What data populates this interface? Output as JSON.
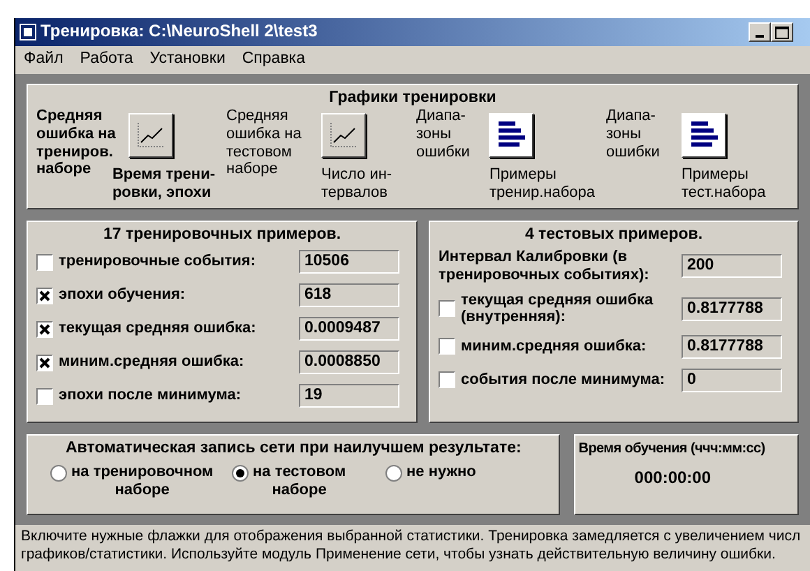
{
  "window": {
    "title": "Тренировка: C:\\NeuroShell 2\\test3"
  },
  "menu": [
    "Файл",
    "Работа",
    "Установки",
    "Справка"
  ],
  "charts": {
    "title": "Графики тренировки",
    "buttons": [
      {
        "side_label": "Средняя\nошибка на\nтрениров.\nнаборе",
        "under_label": "Время трени-\nровки, эпохи",
        "kind": "line",
        "selected": true
      },
      {
        "side_label": "Средняя\nошибка на\nтестовом\nнаборе",
        "under_label": "Число ин-\nтервалов",
        "kind": "line",
        "selected": false
      },
      {
        "side_label": "Диапа-\nзоны\nошибки",
        "under_label": "Примеры\nтренир.набора",
        "kind": "bars",
        "selected": false
      },
      {
        "side_label": "Диапа-\nзоны\nошибки",
        "under_label": "Примеры\nтест.набора",
        "kind": "bars",
        "selected": false
      }
    ]
  },
  "training": {
    "title": "17 тренировочных примеров.",
    "rows": [
      {
        "kind": "checkbox",
        "label": "тренировочные события:",
        "checked": false,
        "value": "10506"
      },
      {
        "kind": "checkbox",
        "label": "эпохи обучения:",
        "checked": true,
        "value": "618"
      },
      {
        "kind": "checkbox",
        "label": "текущая средняя ошибка:",
        "checked": true,
        "value": "0.0009487"
      },
      {
        "kind": "checkbox",
        "label": "миним.средняя ошибка:",
        "checked": true,
        "value": "0.0008850"
      },
      {
        "kind": "checkbox",
        "label": "эпохи после минимума:",
        "checked": false,
        "value": "19"
      }
    ]
  },
  "testing": {
    "title": "4 тестовых примеров.",
    "rows": [
      {
        "kind": "plain",
        "label": "Интервал Калибровки (в\nтренировочных событиях):",
        "value": "200"
      },
      {
        "kind": "checkbox",
        "label": "текущая средняя ошибка\n(внутренняя):",
        "checked": false,
        "value": "0.8177788"
      },
      {
        "kind": "checkbox",
        "label": "миним.средняя ошибка:",
        "checked": false,
        "value": "0.8177788"
      },
      {
        "kind": "checkbox",
        "label": "события после минимума:",
        "checked": false,
        "value": "0"
      }
    ]
  },
  "autosave": {
    "title": "Автоматическая запись сети при наилучшем результате:",
    "options": [
      {
        "label": "на тренировочном\nнаборе",
        "selected": false
      },
      {
        "label": "на тестовом\nнаборе",
        "selected": true
      },
      {
        "label": "не нужно",
        "selected": false
      }
    ]
  },
  "time": {
    "title": "Время обучения (ччч:мм:сс)",
    "value": "000:00:00"
  },
  "status_bar": "Включите нужные флажки для отображения выбранной статистики. Тренировка замедляется с увеличением числ\nграфиков/статистики. Используйте модуль Применение сети, чтобы узнать действительную величину ошибки."
}
